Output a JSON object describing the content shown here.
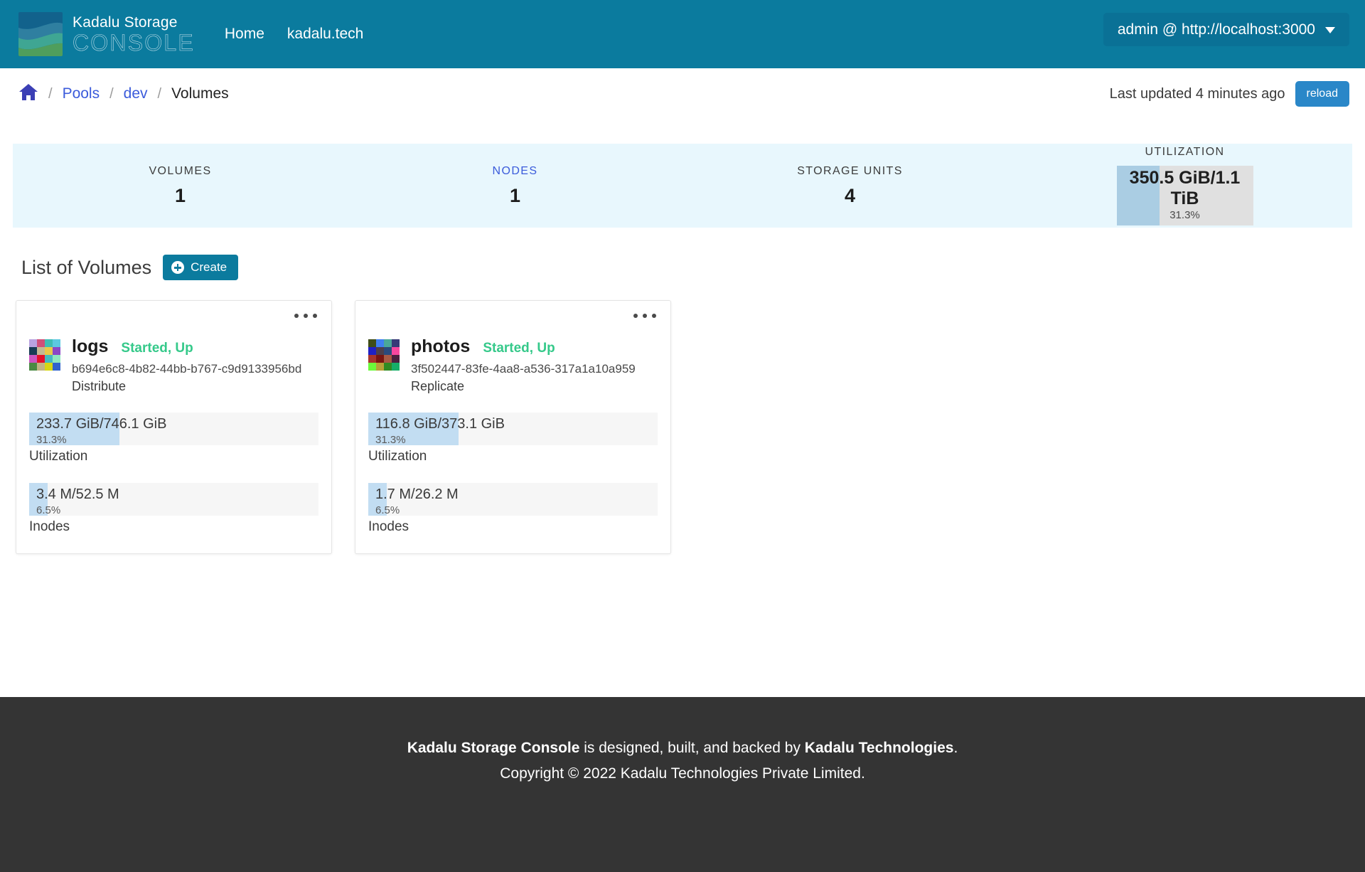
{
  "navbar": {
    "brand_line1": "Kadalu Storage",
    "brand_line2": "CONSOLE",
    "links": [
      {
        "label": "Home"
      },
      {
        "label": "kadalu.tech"
      }
    ],
    "user_menu": "admin @ http://localhost:3000",
    "bg_color": "#0b7b9e"
  },
  "breadcrumb": {
    "home_icon": "home-icon",
    "sep": "/",
    "items": [
      {
        "label": "Pools",
        "is_link": true
      },
      {
        "label": "dev",
        "is_link": true
      },
      {
        "label": "Volumes",
        "is_link": false
      }
    ],
    "last_updated": "Last updated 4 minutes ago",
    "reload_label": "reload",
    "reload_color": "#2a87c8"
  },
  "stats": [
    {
      "label": "VOLUMES",
      "value": "1",
      "is_link": false
    },
    {
      "label": "NODES",
      "value": "1",
      "is_link": true
    },
    {
      "label": "STORAGE UNITS",
      "value": "4",
      "is_link": false
    }
  ],
  "utilization": {
    "label": "UTILIZATION",
    "text": "350.5 GiB/1.1 TiB",
    "percent_text": "31.3%",
    "percent": 31.3,
    "fill_color": "#aacde3",
    "track_color": "#e0e0e0"
  },
  "list": {
    "title": "List of Volumes",
    "create_label": "Create",
    "create_icon": "plus-circle-icon"
  },
  "volumes": [
    {
      "name": "logs",
      "state": "Started, Up",
      "state_color": "#35c98a",
      "uuid": "b694e6c8-4b82-44bb-b767-c9d9133956bd",
      "type": "Distribute",
      "menu_icon": "kebab-menu-icon",
      "identicon": [
        "#b9a2e0",
        "#cf4f79",
        "#3fbdb4",
        "#5cc9e0",
        "#173b55",
        "#c4b994",
        "#e8c949",
        "#8b47c6",
        "#cc55c0",
        "#e3102a",
        "#45b9c0",
        "#8fe8bf",
        "#4a8a43",
        "#c2b483",
        "#d7d712",
        "#3163cc"
      ],
      "metrics": [
        {
          "text": "233.7 GiB/746.1 GiB",
          "percent_text": "31.3%",
          "percent": 31.3,
          "caption": "Utilization"
        },
        {
          "text": "3.4 M/52.5 M",
          "percent_text": "6.5%",
          "percent": 6.5,
          "caption": "Inodes"
        }
      ]
    },
    {
      "name": "photos",
      "state": "Started, Up",
      "state_color": "#35c98a",
      "uuid": "3f502447-83fe-4aa8-a536-317a1a10a959",
      "type": "Replicate",
      "menu_icon": "kebab-menu-icon",
      "identicon": [
        "#3f4d18",
        "#3f7ff0",
        "#4aa898",
        "#373a78",
        "#2020c4",
        "#4d3f4b",
        "#2a4a7c",
        "#f7479f",
        "#a8342c",
        "#7a1510",
        "#a85a44",
        "#4a2040",
        "#6bfa3a",
        "#b7a238",
        "#2f8a22",
        "#16ad68"
      ],
      "metrics": [
        {
          "text": "116.8 GiB/373.1 GiB",
          "percent_text": "31.3%",
          "percent": 31.3,
          "caption": "Utilization"
        },
        {
          "text": "1.7 M/26.2 M",
          "percent_text": "6.5%",
          "percent": 6.5,
          "caption": "Inodes"
        }
      ]
    }
  ],
  "footer": {
    "line1_bold1": "Kadalu Storage Console",
    "line1_mid": " is designed, built, and backed by ",
    "line1_bold2": "Kadalu Technologies",
    "line1_end": ".",
    "line2": "Copyright © 2022 Kadalu Technologies Private Limited."
  }
}
